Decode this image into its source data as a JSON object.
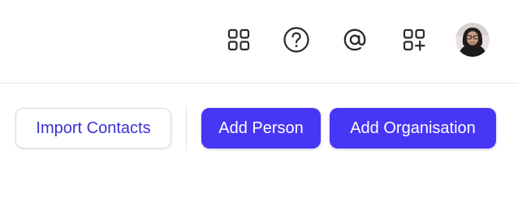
{
  "header": {
    "icons": [
      {
        "name": "apps-grid-icon",
        "label": ""
      },
      {
        "name": "help-icon",
        "label": ""
      },
      {
        "name": "mentions-icon",
        "label": ""
      },
      {
        "name": "add-app-icon",
        "label": ""
      }
    ],
    "avatar_name": "user-avatar"
  },
  "actions": {
    "import_label": "Import Contacts",
    "add_person_label": "Add Person",
    "add_org_label": "Add Organisation"
  },
  "colors": {
    "primary": "#4636f5",
    "primary_text": "#3d30d6",
    "icon": "#2a2a2e"
  }
}
